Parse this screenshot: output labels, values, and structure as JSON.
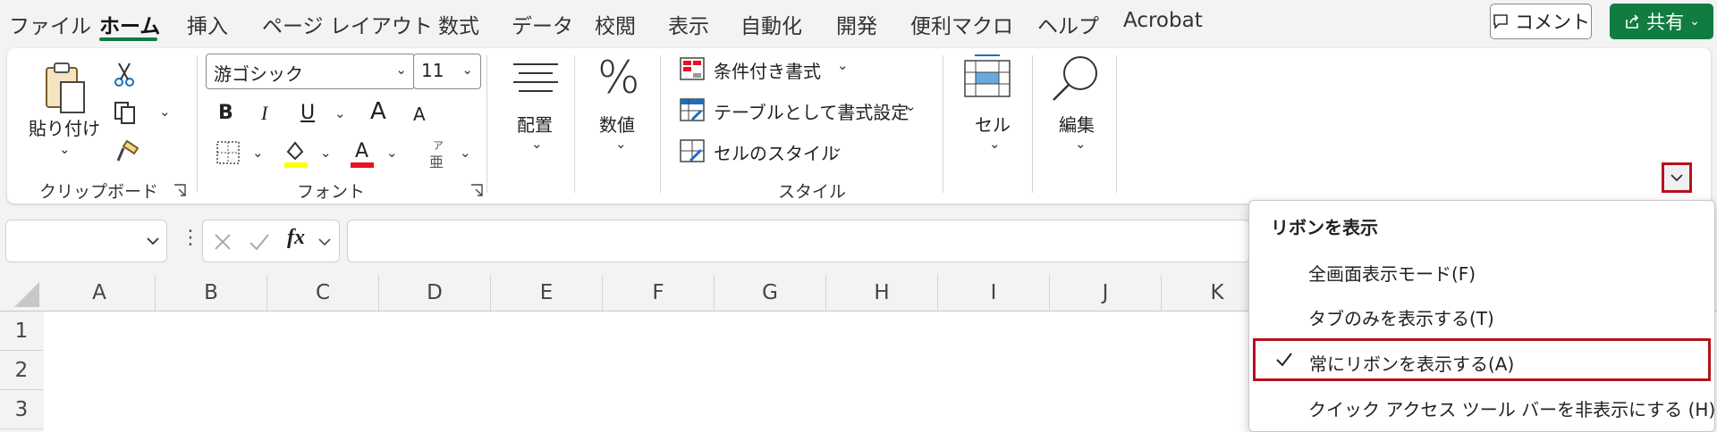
{
  "tabs": [
    "ファイル",
    "ホーム",
    "挿入",
    "ページ レイアウト",
    "数式",
    "データ",
    "校閲",
    "表示",
    "自動化",
    "開発",
    "便利マクロ",
    "ヘルプ",
    "Acrobat"
  ],
  "header": {
    "comment_label": "コメント",
    "share_label": "共有"
  },
  "ribbon": {
    "clipboard": {
      "paste_label": "貼り付け",
      "group_label": "クリップボード"
    },
    "font": {
      "font_name": "游ゴシック",
      "font_size": "11",
      "group_label": "フォント",
      "bold": "B",
      "italic": "I",
      "underline": "U",
      "grow": "A",
      "shrink": "A",
      "phonetic_top": "ア",
      "phonetic_bottom": "亜"
    },
    "alignment": {
      "label": "配置"
    },
    "number": {
      "label": "数値",
      "symbol": "%"
    },
    "styles": {
      "conditional": "条件付き書式",
      "table": "テーブルとして書式設定",
      "cell_style": "セルのスタイル",
      "group_label": "スタイル"
    },
    "cells": {
      "label": "セル"
    },
    "editing": {
      "label": "編集"
    }
  },
  "formula_bar": {
    "fx": "fx"
  },
  "columns": [
    "A",
    "B",
    "C",
    "D",
    "E",
    "F",
    "G",
    "H",
    "I",
    "J",
    "K"
  ],
  "rows": [
    "1",
    "2",
    "3"
  ],
  "menu": {
    "title": "リボンを表示",
    "items": [
      {
        "label": "全画面表示モード(F)",
        "checked": false
      },
      {
        "label": "タブのみを表示する(T)",
        "checked": false
      },
      {
        "label": "常にリボンを表示する(A)",
        "checked": true
      },
      {
        "label": "クイック アクセス ツール バーを非表示にする (H)",
        "checked": false
      }
    ]
  },
  "colors": {
    "accent": "#107c41",
    "highlight": "#b5121b",
    "font_color_bar": "#e81123",
    "highlight_color_bar": "#ffff00"
  }
}
